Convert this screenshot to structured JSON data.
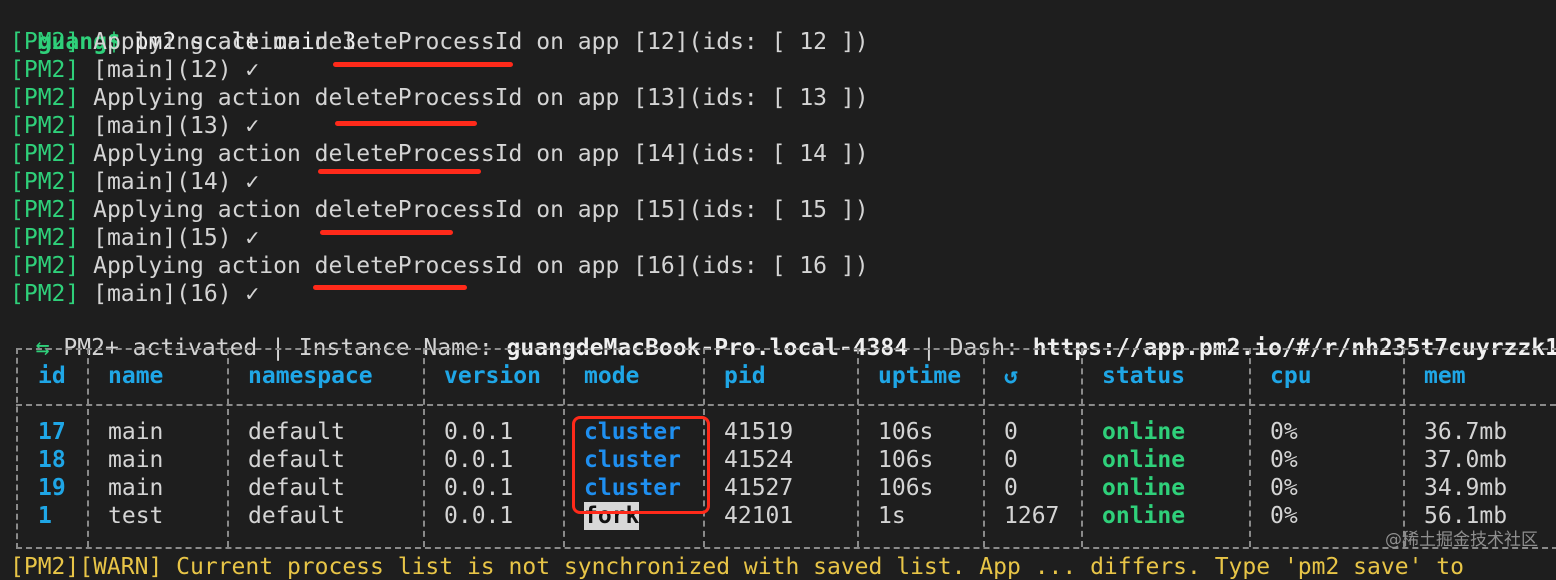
{
  "terminal": {
    "prompt": "guang$",
    "command": "pm2 scale main 3",
    "output_lines": [
      {
        "tag": "[PM2]",
        "text": "Applying action deleteProcessId on app [12](ids: [ 12 ])"
      },
      {
        "tag": "[PM2]",
        "text": "[main](12) ✓"
      },
      {
        "tag": "[PM2]",
        "text": "Applying action deleteProcessId on app [13](ids: [ 13 ])"
      },
      {
        "tag": "[PM2]",
        "text": "[main](13) ✓"
      },
      {
        "tag": "[PM2]",
        "text": "Applying action deleteProcessId on app [14](ids: [ 14 ])"
      },
      {
        "tag": "[PM2]",
        "text": "[main](14) ✓"
      },
      {
        "tag": "[PM2]",
        "text": "Applying action deleteProcessId on app [15](ids: [ 15 ])"
      },
      {
        "tag": "[PM2]",
        "text": "[main](15) ✓"
      },
      {
        "tag": "[PM2]",
        "text": "Applying action deleteProcessId on app [16](ids: [ 16 ])"
      },
      {
        "tag": "[PM2]",
        "text": "[main](16) ✓"
      }
    ],
    "activated": {
      "icon": "⇆",
      "prefix": " PM2+ activated | Instance Name: ",
      "instance": "guangdeMacBook-Pro.local-4384",
      "dash_label": " | Dash: ",
      "dash_url": "https://app.pm2.io/#/r/nh235t7cuyrzzk1"
    },
    "table": {
      "headers": [
        "id",
        "name",
        "namespace",
        "version",
        "mode",
        "pid",
        "uptime",
        "↺",
        "status",
        "cpu",
        "mem"
      ],
      "rows": [
        [
          "17",
          "main",
          "default",
          "0.0.1",
          "cluster",
          "41519",
          "106s",
          "0",
          "online",
          "0%",
          "36.7mb"
        ],
        [
          "18",
          "main",
          "default",
          "0.0.1",
          "cluster",
          "41524",
          "106s",
          "0",
          "online",
          "0%",
          "37.0mb"
        ],
        [
          "19",
          "main",
          "default",
          "0.0.1",
          "cluster",
          "41527",
          "106s",
          "0",
          "online",
          "0%",
          "34.9mb"
        ],
        [
          "1",
          "test",
          "default",
          "0.0.1",
          "fork",
          "42101",
          "1s",
          "1267",
          "online",
          "0%",
          "56.1mb"
        ]
      ]
    },
    "warn_line": "[PM2][WARN] Current process list is not synchronized with saved list. App ... differs. Type 'pm2 save' to",
    "watermark": "@稀土掘金技术社区"
  },
  "colors": {
    "accent_green": "#2fd07a",
    "accent_blue": "#1fa6e6",
    "annotation_red": "#ff2a1a"
  }
}
